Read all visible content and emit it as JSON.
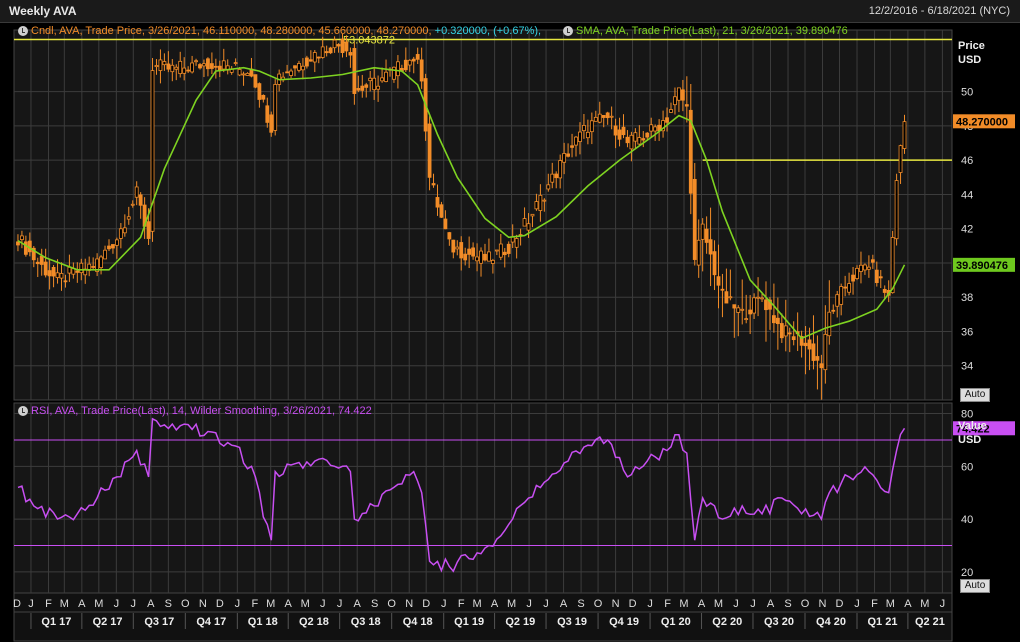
{
  "header": {
    "title": "Weekly AVA",
    "date_range": "12/2/2016 - 6/18/2021 (NYC)"
  },
  "legend": {
    "candle": {
      "base": "Cndl, AVA, Trade Price, 3/26/2021, 46.110000, 48.280000, 45.660000, 48.270000,",
      "change": "+0.320000, (+0.67%),",
      "base_color": "#f28c28",
      "change_color": "#35d4e6"
    },
    "sma": {
      "text": "SMA, AVA, Trade Price(Last), 21, 3/26/2021, 39.890476",
      "color": "#7ed321"
    },
    "rsi": {
      "text": "RSI, AVA, Trade Price(Last), 14, Wilder Smoothing, 3/26/2021, 74.422",
      "color": "#c84ff2"
    }
  },
  "price_axis": {
    "head1": "Price",
    "head2": "USD",
    "auto_label": "Auto"
  },
  "rsi_axis": {
    "head1": "Value",
    "head2": "USD",
    "auto_label": "Auto"
  },
  "chart_data": [
    {
      "type": "candlestick",
      "name": "Cndl, AVA, Trade Price",
      "ylim": [
        32,
        53.6
      ],
      "yticks": [
        34,
        36,
        38,
        40,
        42,
        44,
        46,
        48,
        50
      ],
      "x": [
        "2016-12-09",
        "2017-01-13",
        "2017-02-17",
        "2017-03-24",
        "2017-04-28",
        "2017-06-02",
        "2017-07-07",
        "2017-07-28",
        "2017-08-04",
        "2017-09-08",
        "2017-10-13",
        "2017-11-17",
        "2017-12-22",
        "2018-01-26",
        "2018-03-02",
        "2018-03-09",
        "2018-04-13",
        "2018-05-18",
        "2018-06-22",
        "2018-07-20",
        "2018-07-27",
        "2018-08-31",
        "2018-10-05",
        "2018-11-09",
        "2018-11-23",
        "2018-12-07",
        "2019-01-11",
        "2019-02-15",
        "2019-03-22",
        "2019-04-26",
        "2019-05-31",
        "2019-07-05",
        "2019-08-09",
        "2019-09-13",
        "2019-10-18",
        "2019-11-22",
        "2019-12-27",
        "2020-01-31",
        "2020-02-21",
        "2020-03-06",
        "2020-03-20",
        "2020-04-03",
        "2020-05-08",
        "2020-06-12",
        "2020-07-17",
        "2020-08-21",
        "2020-09-25",
        "2020-10-30",
        "2020-11-13",
        "2020-12-18",
        "2021-01-22",
        "2021-02-26",
        "2021-03-12",
        "2021-03-26"
      ],
      "close": [
        41.5,
        40.0,
        39.0,
        39.5,
        40.0,
        41.5,
        44.0,
        41.5,
        51.5,
        51.3,
        51.5,
        51.7,
        51.4,
        51.2,
        48.0,
        50.8,
        51.5,
        52.2,
        52.8,
        52.5,
        50.0,
        50.5,
        51.2,
        52.0,
        51.0,
        45.0,
        41.0,
        40.5,
        40.2,
        41.0,
        42.5,
        44.5,
        46.5,
        48.0,
        48.5,
        47.0,
        47.5,
        48.5,
        50.0,
        49.0,
        40.0,
        42.0,
        38.0,
        37.0,
        38.0,
        36.0,
        35.5,
        34.0,
        37.0,
        39.0,
        40.0,
        38.0,
        45.0,
        48.27
      ],
      "series": [
        {
          "name": "SMA, AVA, Trade Price(Last), 21",
          "x": [
            "2016-12-09",
            "2017-01-27",
            "2017-03-24",
            "2017-05-19",
            "2017-07-14",
            "2017-08-25",
            "2017-10-20",
            "2017-11-24",
            "2018-01-12",
            "2018-02-09",
            "2018-03-16",
            "2018-05-11",
            "2018-07-06",
            "2018-08-31",
            "2018-10-19",
            "2018-11-16",
            "2018-12-21",
            "2019-01-25",
            "2019-03-15",
            "2019-04-26",
            "2019-05-24",
            "2019-07-19",
            "2019-09-13",
            "2019-11-08",
            "2020-01-10",
            "2020-02-21",
            "2020-03-13",
            "2020-04-10",
            "2020-05-08",
            "2020-06-26",
            "2020-08-07",
            "2020-09-25",
            "2020-11-06",
            "2020-12-18",
            "2021-02-05",
            "2021-03-05",
            "2021-03-26"
          ],
          "values": [
            41.3,
            40.3,
            39.6,
            39.6,
            41.5,
            45.5,
            49.5,
            51.2,
            51.4,
            51.2,
            50.7,
            50.8,
            51.0,
            51.4,
            51.2,
            50.4,
            47.5,
            45.0,
            42.6,
            41.5,
            41.6,
            42.7,
            44.5,
            46.0,
            47.5,
            48.6,
            48.3,
            46.0,
            43.0,
            39.0,
            37.5,
            35.6,
            36.2,
            36.6,
            37.3,
            38.5,
            39.890476
          ]
        }
      ],
      "annotations": [
        {
          "text": "53.043872",
          "value": 53.043872
        },
        {
          "text": "46",
          "value": 46.0
        }
      ],
      "last_price_label": "48.270000",
      "sma_last_label": "39.890476",
      "price_ticks": [
        "34",
        "36",
        "38",
        "40",
        "42",
        "44",
        "46",
        "48",
        "50"
      ]
    },
    {
      "type": "line",
      "name": "RSI, AVA, Trade Price(Last), 14, Wilder Smoothing",
      "ylim": [
        12,
        84
      ],
      "yticks": [
        20,
        40,
        60,
        80
      ],
      "reference_lines": [
        30,
        70
      ],
      "x": [
        "2016-12-09",
        "2017-01-13",
        "2017-02-17",
        "2017-03-24",
        "2017-04-28",
        "2017-06-02",
        "2017-07-07",
        "2017-07-28",
        "2017-08-04",
        "2017-09-08",
        "2017-10-13",
        "2017-11-17",
        "2017-12-22",
        "2018-01-26",
        "2018-03-02",
        "2018-03-09",
        "2018-04-13",
        "2018-05-18",
        "2018-06-22",
        "2018-07-20",
        "2018-07-27",
        "2018-08-31",
        "2018-10-05",
        "2018-11-09",
        "2018-11-23",
        "2018-12-07",
        "2019-01-11",
        "2019-02-15",
        "2019-03-22",
        "2019-04-26",
        "2019-05-31",
        "2019-07-05",
        "2019-08-09",
        "2019-09-13",
        "2019-10-18",
        "2019-11-22",
        "2019-12-27",
        "2020-01-31",
        "2020-02-21",
        "2020-03-06",
        "2020-03-20",
        "2020-04-03",
        "2020-05-08",
        "2020-06-12",
        "2020-07-17",
        "2020-08-21",
        "2020-09-25",
        "2020-10-30",
        "2020-11-13",
        "2020-12-18",
        "2021-01-22",
        "2021-02-26",
        "2021-03-12",
        "2021-03-26"
      ],
      "values": [
        52,
        44,
        40,
        42,
        48,
        56,
        66,
        56,
        78,
        76,
        74,
        73,
        68,
        60,
        32,
        58,
        61,
        62,
        60,
        58,
        40,
        45,
        52,
        58,
        50,
        24,
        22,
        25,
        30,
        38,
        48,
        55,
        62,
        68,
        70,
        56,
        62,
        66,
        72,
        65,
        32,
        48,
        40,
        45,
        42,
        48,
        42,
        40,
        50,
        56,
        58,
        50,
        66,
        74.422
      ],
      "last_value_label": "74.422",
      "value_ticks": [
        "20",
        "40",
        "60",
        "80"
      ]
    }
  ],
  "x_axis": {
    "months": [
      "D",
      "J",
      "F",
      "M",
      "A",
      "M",
      "J",
      "J",
      "A",
      "S",
      "O",
      "N",
      "D",
      "J",
      "F",
      "M",
      "A",
      "M",
      "J",
      "J",
      "A",
      "S",
      "O",
      "N",
      "D",
      "J",
      "F",
      "M",
      "A",
      "M",
      "J",
      "J",
      "A",
      "S",
      "O",
      "N",
      "D",
      "J",
      "F",
      "M",
      "A",
      "M",
      "J",
      "J",
      "A",
      "S",
      "O",
      "N",
      "D",
      "J",
      "F",
      "M",
      "A",
      "M",
      "J"
    ],
    "quarters": [
      "Q1 17",
      "Q2 17",
      "Q3 17",
      "Q4 17",
      "Q1 18",
      "Q2 18",
      "Q3 18",
      "Q4 18",
      "Q1 19",
      "Q2 19",
      "Q3 19",
      "Q4 19",
      "Q1 20",
      "Q2 20",
      "Q3 20",
      "Q4 20",
      "Q1 21",
      "Q2 21"
    ]
  },
  "colors": {
    "candle": "#f28c28",
    "sma": "#7ed321",
    "rsi": "#c84ff2",
    "hline": "#e8e840",
    "grid": "#3c3c3c",
    "sma_badge": "#6ec81e",
    "price_badge": "#f28c28",
    "rsi_badge": "#c84ff2"
  }
}
